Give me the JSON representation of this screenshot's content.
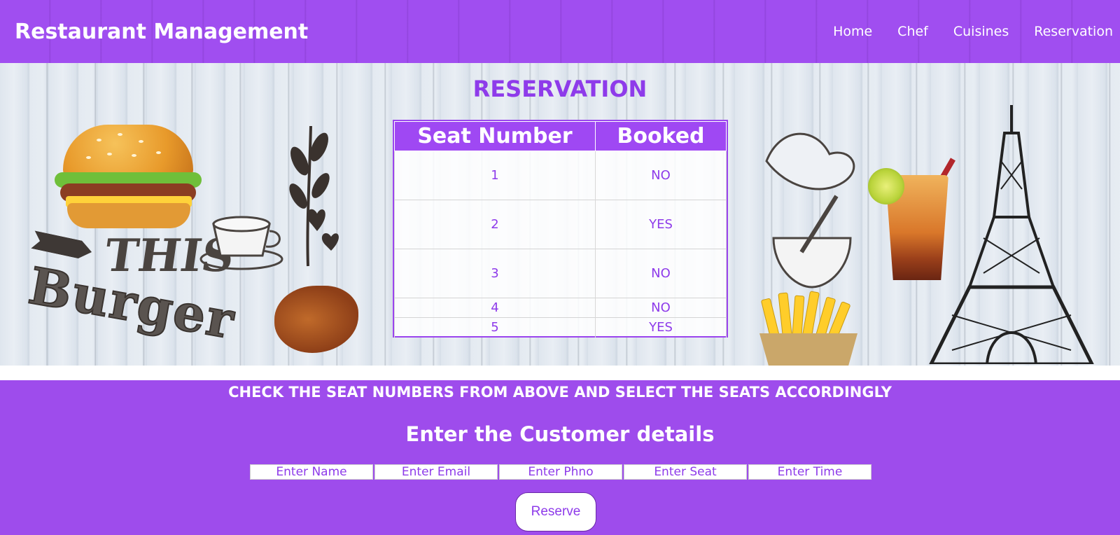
{
  "header": {
    "brand": "Restaurant Management",
    "nav": [
      "Home",
      "Chef",
      "Cuisines",
      "Reservation"
    ]
  },
  "hero": {
    "decor_text_1": "THIS",
    "decor_text_2": "Burger"
  },
  "reservation": {
    "title": "RESERVATION",
    "columns": [
      "Seat Number",
      "Booked"
    ],
    "rows": [
      [
        "1",
        "NO"
      ],
      [
        "2",
        "YES"
      ],
      [
        "3",
        "NO"
      ],
      [
        "4",
        "NO"
      ],
      [
        "5",
        "YES"
      ]
    ]
  },
  "form": {
    "instruction": "CHECK THE SEAT NUMBERS FROM ABOVE AND SELECT THE SEATS ACCORDINGLY",
    "title": "Enter the Customer details",
    "placeholders": {
      "name": "Enter Name",
      "email": "Enter Email",
      "phone": "Enter Phno",
      "seat": "Enter Seat",
      "time": "Enter Time"
    },
    "submit_label": "Reserve"
  },
  "colors": {
    "primary_purple": "#a04ef0",
    "text_purple": "#8e3bea",
    "white": "#ffffff"
  },
  "icons": [
    "burger-illustration",
    "drink-illustration",
    "fries-illustration",
    "eiffel-tower-illustration",
    "chicken-wings-illustration"
  ]
}
